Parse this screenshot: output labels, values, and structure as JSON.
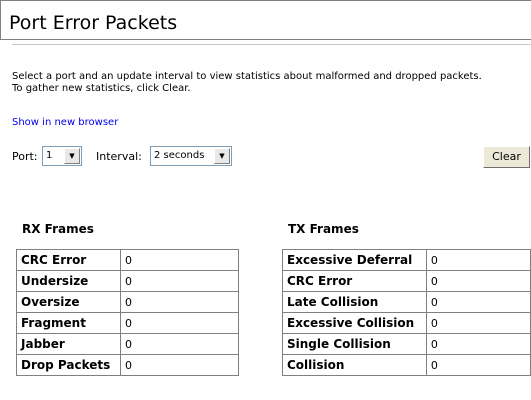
{
  "header": {
    "title": "Port Error Packets"
  },
  "description": {
    "line1": "Select a port and an update interval to view statistics about malformed and dropped packets.",
    "line2": "To gather new statistics, click Clear."
  },
  "link": {
    "label": "Show in new browser"
  },
  "controls": {
    "port_label": "Port:",
    "port_value": "1",
    "interval_label": "Interval:",
    "interval_value": "2 seconds",
    "clear_label": "Clear"
  },
  "rx": {
    "title": "RX Frames",
    "rows": [
      {
        "label": "CRC Error",
        "value": "0"
      },
      {
        "label": "Undersize",
        "value": "0"
      },
      {
        "label": "Oversize",
        "value": "0"
      },
      {
        "label": "Fragment",
        "value": "0"
      },
      {
        "label": "Jabber",
        "value": "0"
      },
      {
        "label": "Drop Packets",
        "value": "0"
      }
    ]
  },
  "tx": {
    "title": "TX Frames",
    "rows": [
      {
        "label": "Excessive Deferral",
        "value": "0"
      },
      {
        "label": "CRC Error",
        "value": "0"
      },
      {
        "label": "Late Collision",
        "value": "0"
      },
      {
        "label": "Excessive Collision",
        "value": "0"
      },
      {
        "label": "Single Collision",
        "value": "0"
      },
      {
        "label": "Collision",
        "value": "0"
      }
    ]
  }
}
